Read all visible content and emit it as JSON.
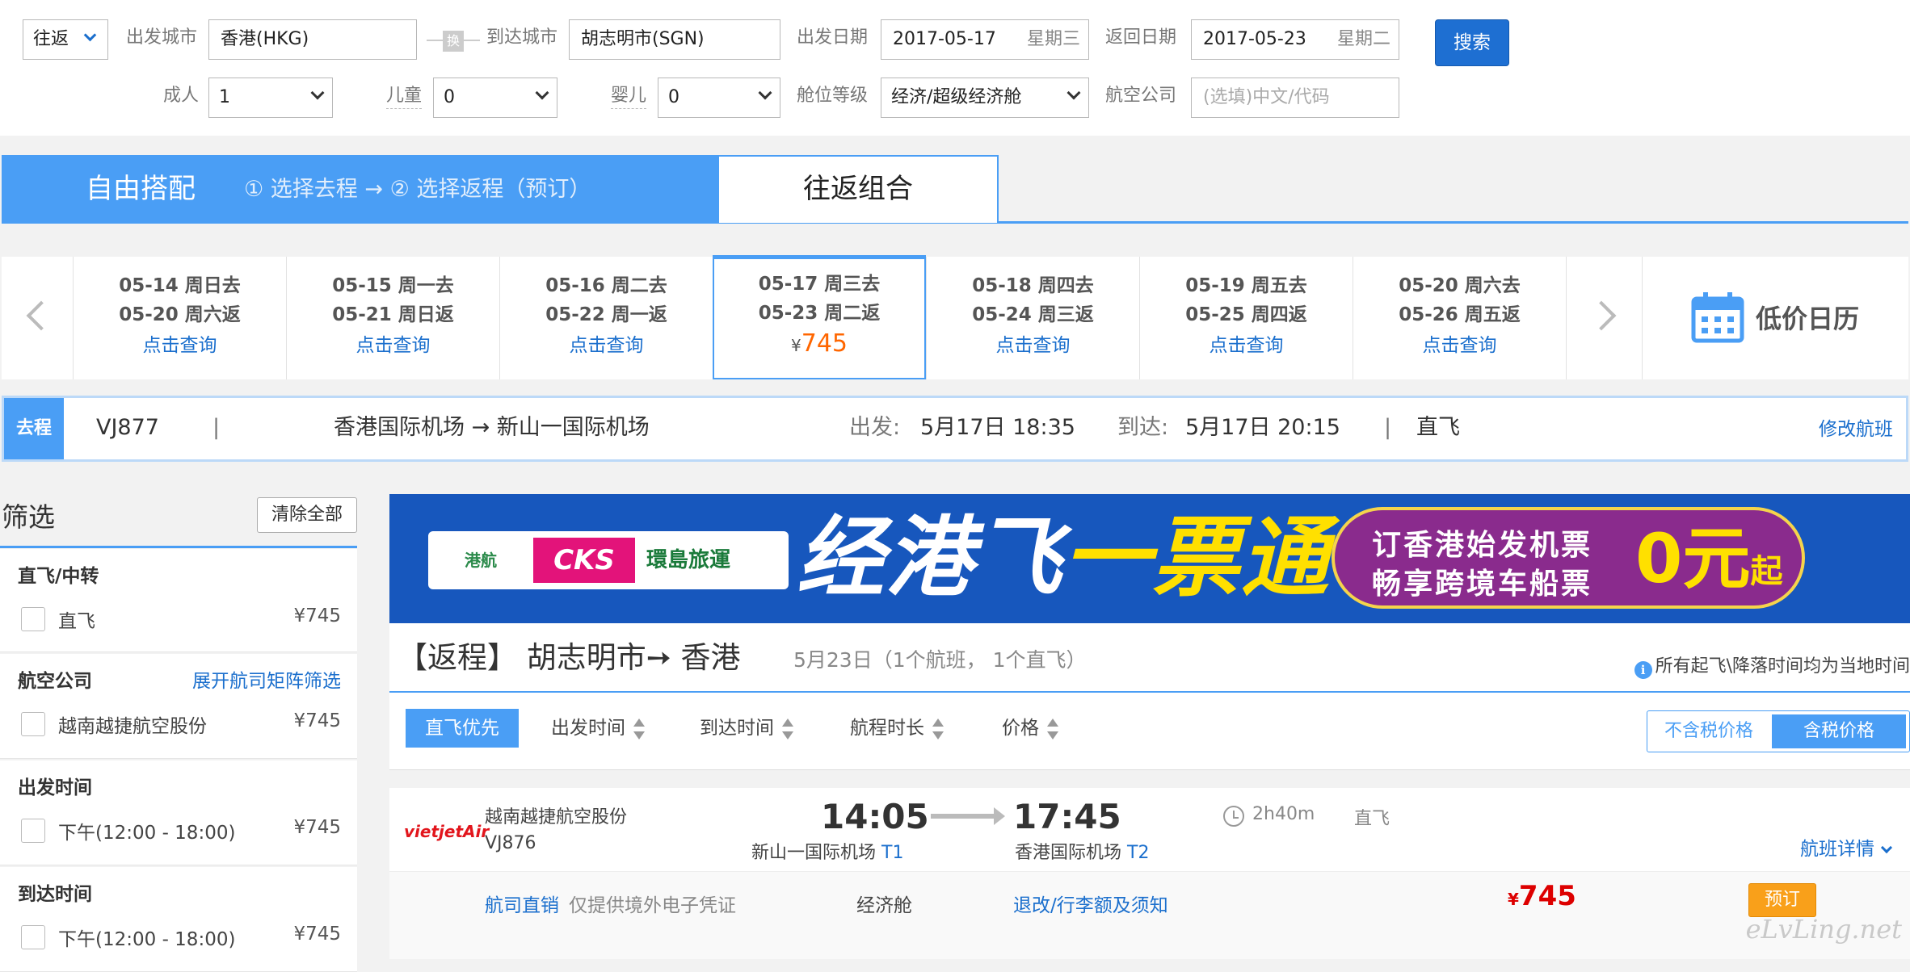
{
  "search": {
    "trip_type": "往返",
    "from_label": "出发城市",
    "from_value": "香港(HKG)",
    "swap_label": "换",
    "to_label": "到达城市",
    "to_value": "胡志明市(SGN)",
    "depart_label": "出发日期",
    "depart_date": "2017-05-17",
    "depart_weekday": "星期三",
    "return_label": "返回日期",
    "return_date": "2017-05-23",
    "return_weekday": "星期二",
    "search_btn": "搜索",
    "adult_label": "成人",
    "adult_value": "1",
    "child_label": "儿童",
    "child_value": "0",
    "infant_label": "婴儿",
    "infant_value": "0",
    "cabin_label": "舱位等级",
    "cabin_value": "经济/超级经济舱",
    "airline_label": "航空公司",
    "airline_placeholder": "(选填)中文/代码"
  },
  "mode": {
    "free": "自由搭配",
    "steps": "① 选择去程  →  ② 选择返程（预订）",
    "roundtrip": "往返组合"
  },
  "dates": [
    {
      "go": "05-14 周日去",
      "back": "05-20 周六返",
      "action": "点击查询"
    },
    {
      "go": "05-15 周一去",
      "back": "05-21 周日返",
      "action": "点击查询"
    },
    {
      "go": "05-16 周二去",
      "back": "05-22 周一返",
      "action": "点击查询"
    },
    {
      "go": "05-17 周三去",
      "back": "05-23 周二返",
      "currency": "¥",
      "price": "745"
    },
    {
      "go": "05-18 周四去",
      "back": "05-24 周三返",
      "action": "点击查询"
    },
    {
      "go": "05-19 周五去",
      "back": "05-25 周四返",
      "action": "点击查询"
    },
    {
      "go": "05-20 周六去",
      "back": "05-26 周五返",
      "action": "点击查询"
    }
  ],
  "calendar_label": "低价日历",
  "outbound": {
    "tag": "去程",
    "flight_no": "VJ877",
    "sep": "|",
    "route": "香港国际机场 → 新山一国际机场",
    "dep_label": "出发:",
    "dep_time": "5月17日 18:35",
    "arr_label": "到达:",
    "arr_time": "5月17日 20:15",
    "sep2": "|",
    "type": "直飞",
    "modify": "修改航班"
  },
  "filter": {
    "title": "筛选",
    "clear": "清除全部",
    "sections": [
      {
        "title": "直飞/中转",
        "option": "直飞",
        "price": "¥745"
      },
      {
        "title": "航空公司",
        "link": "展开航司矩阵筛选",
        "option": "越南越捷航空股份",
        "price": "¥745"
      },
      {
        "title": "出发时间",
        "option": "下午(12:00 - 18:00)",
        "price": "¥745"
      },
      {
        "title": "到达时间",
        "option": "下午(12:00 - 18:00)",
        "price": "¥745"
      }
    ]
  },
  "banner": {
    "logo1": "港航",
    "logo2": "CKS",
    "logo3": "環島旅運",
    "main_white": "经港飞",
    "main_yellow": "一票通",
    "pill_line1": "订香港始发机票",
    "pill_line2": "畅享跨境车船票",
    "pill_zero": "0元",
    "pill_suffix": "起"
  },
  "return_header": {
    "title": "【返程】 胡志明市➙ 香港",
    "subtitle": "5月23日（1个航班， 1个直飞）",
    "note": "所有起飞\\降落时间均为当地时间"
  },
  "sort": {
    "direct_first": "直飞优先",
    "dep_time": "出发时间",
    "arr_time": "到达时间",
    "duration": "航程时长",
    "price": "价格",
    "tax_excluded": "不含税价格",
    "tax_included": "含税价格"
  },
  "flight": {
    "logo_text": "vietjetAir",
    "airline": "越南越捷航空股份",
    "flight_no": "VJ876",
    "dep_time": "14:05",
    "arr_time": "17:45",
    "dep_airport": "新山一国际机场",
    "dep_terminal": "T1",
    "arr_airport": "香港国际机场",
    "arr_terminal": "T2",
    "duration": "2h40m",
    "type": "直飞",
    "detail": "航班详情",
    "source": "航司直销",
    "source_note": "仅提供境外电子凭证",
    "cabin": "经济舱",
    "rules": "退改/行李额及须知",
    "currency": "¥",
    "price": "745",
    "book": "预订"
  },
  "watermark": "eLvLing.net",
  "colors": {
    "accent": "#4a9ef5",
    "link": "#1b6fcd",
    "price": "#dd0000",
    "book": "#f9a01a"
  }
}
